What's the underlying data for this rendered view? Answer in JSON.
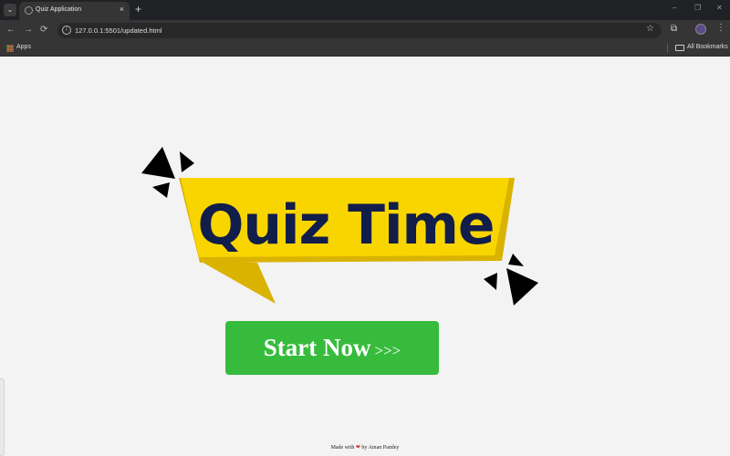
{
  "browser": {
    "tab_title": "Quiz Application",
    "tab_close": "×",
    "new_tab": "+",
    "url": "127.0.0.1:5501/updated.html",
    "bookmarks": {
      "apps": "Apps",
      "all_bookmarks": "All Bookmarks"
    },
    "window": {
      "minimize": "–",
      "restore": "❐",
      "close": "✕"
    },
    "nav": {
      "back": "←",
      "forward": "→",
      "reload": "⟳"
    },
    "icons": {
      "star": "☆",
      "extensions": "⧉",
      "menu": "⋮",
      "tab_search": "⌄"
    }
  },
  "hero": {
    "title": "Quiz Time",
    "colors": {
      "banner": "#f9d500",
      "banner_shadow": "#d9b300",
      "text": "#111d4a",
      "sparkles": "#000000"
    }
  },
  "start_button": {
    "label": "Start Now",
    "arrows": ">>>",
    "color": "#37bb3d"
  },
  "footer": {
    "prefix": "Made with",
    "heart": "❤",
    "suffix": "by Aman Pandey"
  }
}
